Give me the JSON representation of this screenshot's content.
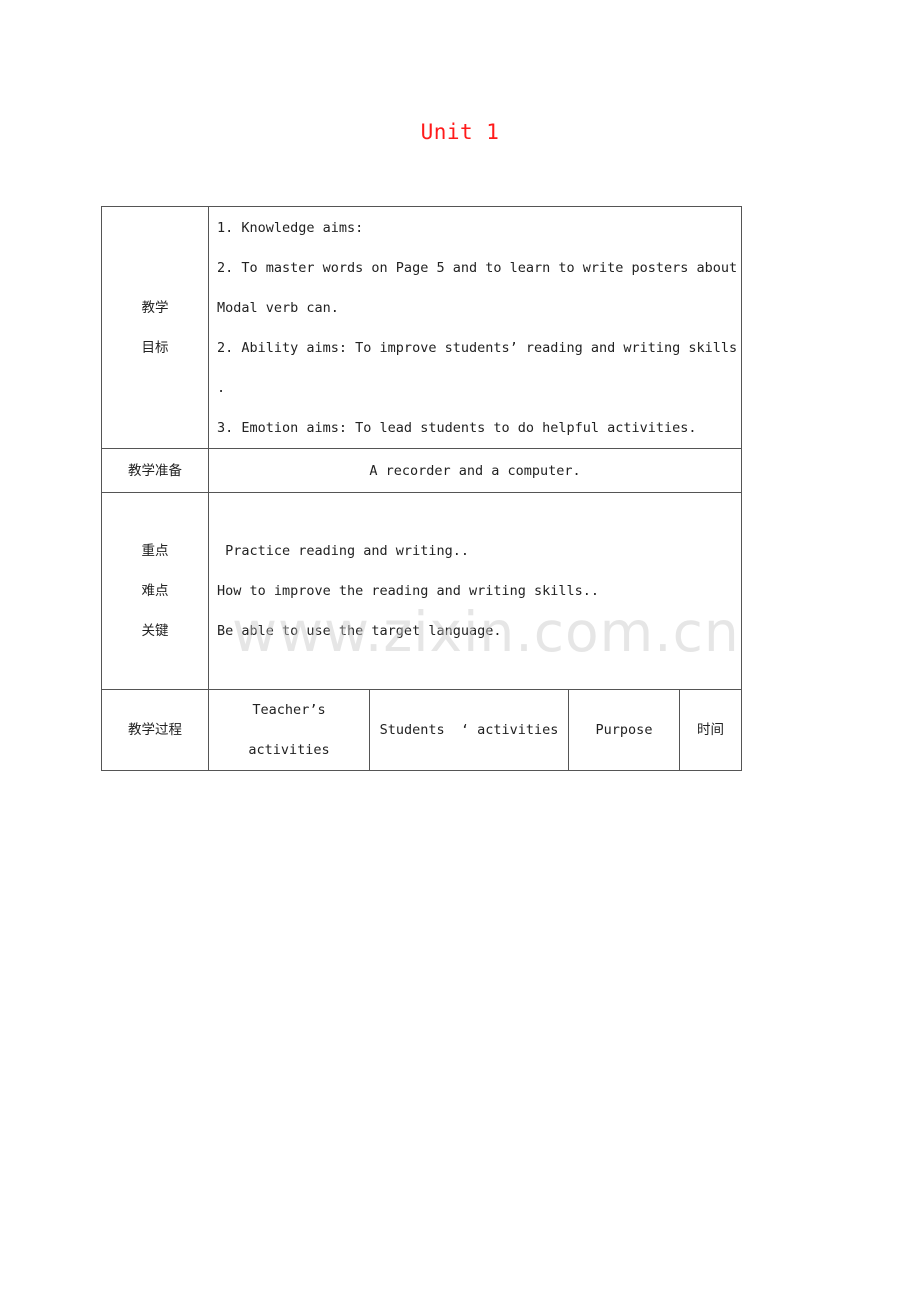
{
  "document": {
    "title": "Unit 1",
    "title_color": "#ff1a1a",
    "watermark": "www.zixin.com.cn"
  },
  "table": {
    "objectives": {
      "label_lines": [
        "教学",
        "目标"
      ],
      "lines": [
        "1. Knowledge aims:",
        "2. To master words on Page 5 and to learn to write posters about",
        "Modal verb can.",
        "2. Ability aims: To improve students’  reading and writing skills",
        ".",
        "3. Emotion aims: To lead students to do helpful activities."
      ]
    },
    "preparation": {
      "label": "教学准备",
      "value": "A recorder and a computer."
    },
    "key_points": {
      "label_lines": [
        "重点",
        "难点",
        "关键"
      ],
      "lines": [
        " Practice reading and writing..",
        "How to improve the reading and writing skills..",
        "Be able to use the target language."
      ]
    },
    "process": {
      "label": "教学过程",
      "columns": [
        {
          "lines": [
            "Teacher’s",
            "activities"
          ]
        },
        {
          "lines": [
            "Students  ‘ activities"
          ]
        },
        {
          "lines": [
            "Purpose"
          ]
        },
        {
          "lines": [
            "时间"
          ]
        }
      ]
    }
  }
}
